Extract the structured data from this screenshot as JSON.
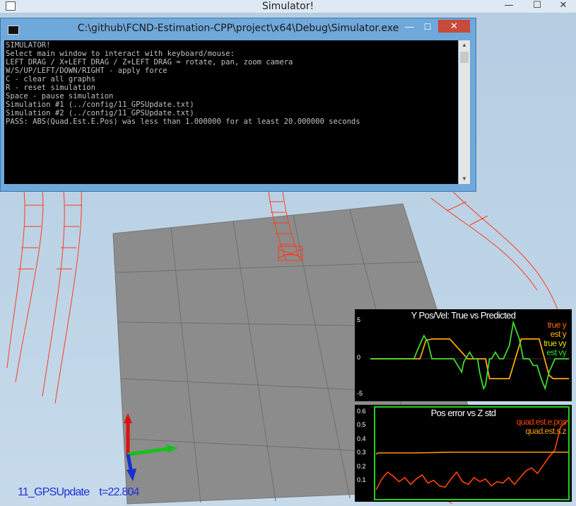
{
  "window": {
    "title": "Simulator!",
    "minimize": "—",
    "maximize": "☐",
    "close": "✕"
  },
  "console": {
    "title": "C:\\github\\FCND-Estimation-CPP\\project\\x64\\Debug\\Simulator.exe",
    "minimize": "—",
    "maximize": "☐",
    "close": "✕",
    "scroll_up": "▲",
    "scroll_down": "▼",
    "lines": [
      "SIMULATOR!",
      "Select main window to interact with keyboard/mouse:",
      "LEFT DRAG / X+LEFT DRAG / Z+LEFT DRAG = rotate, pan, zoom camera",
      "W/S/UP/LEFT/DOWN/RIGHT - apply force",
      "C - clear all graphs",
      "R - reset simulation",
      "Space - pause simulation",
      "Simulation #1 (../config/11_GPSUpdate.txt)",
      "Simulation #2 (../config/11_GPSUpdate.txt)",
      "PASS: ABS(Quad.Est.E.Pos) was less than 1.000000 for at least 20.000000 seconds"
    ]
  },
  "scenario": {
    "name": "11_GPSUpdate",
    "time_label": "t=22.804"
  },
  "chart_data": [
    {
      "type": "line",
      "title": "Y Pos/Vel: True vs Predicted",
      "ylim": [
        -6,
        6
      ],
      "xlim": [
        0,
        100
      ],
      "yticks": [
        "5",
        "0",
        "-5"
      ],
      "series": [
        {
          "name": "true y",
          "color": "#ff6a00",
          "x": [
            0,
            25,
            28,
            31,
            40,
            46,
            49,
            52,
            55,
            58,
            60,
            65,
            70,
            73,
            76,
            78,
            85,
            90,
            92,
            95,
            100
          ],
          "values": [
            0,
            0,
            2.8,
            3,
            3,
            1,
            0,
            0,
            0,
            0,
            -3,
            -3,
            -3,
            0,
            3,
            3,
            3,
            -2.5,
            -3,
            -3,
            -3
          ]
        },
        {
          "name": "est y",
          "color": "#ffb000",
          "x": [
            0,
            25,
            28,
            31,
            40,
            46,
            49,
            52,
            55,
            58,
            60,
            65,
            70,
            73,
            76,
            78,
            85,
            90,
            92,
            95,
            100
          ],
          "values": [
            0,
            0,
            2.8,
            3,
            3,
            1,
            0,
            0,
            0,
            0,
            -3,
            -3,
            -3,
            0,
            3,
            3,
            3,
            -2.5,
            -3,
            -3,
            -3
          ]
        },
        {
          "name": "true vy",
          "color": "#d8e000",
          "x": [
            0,
            22,
            24,
            27,
            29,
            31,
            42,
            44,
            46,
            47,
            50,
            52,
            54,
            55,
            57,
            58,
            60,
            61,
            63,
            65,
            67,
            70,
            72,
            75,
            77,
            80,
            82,
            84,
            86,
            88,
            90,
            93,
            95,
            100
          ],
          "values": [
            0,
            0,
            1.5,
            3.5,
            2.5,
            0,
            0,
            -1,
            -2,
            -0.5,
            1,
            0,
            0,
            -2,
            -4.5,
            -4,
            0,
            0,
            1,
            0,
            0,
            2,
            5.5,
            3,
            0,
            0,
            -1,
            -1,
            -3,
            -4.5,
            -2,
            0,
            0,
            0
          ]
        },
        {
          "name": "est vy",
          "color": "#33dd33",
          "x": [
            0,
            22,
            24,
            27,
            29,
            31,
            42,
            44,
            46,
            47,
            50,
            52,
            54,
            55,
            57,
            58,
            60,
            61,
            63,
            65,
            67,
            70,
            72,
            75,
            77,
            80,
            82,
            84,
            86,
            88,
            90,
            93,
            95,
            100
          ],
          "values": [
            0,
            0,
            1.5,
            3.5,
            2.5,
            0,
            0,
            -1,
            -2,
            -0.5,
            1,
            0,
            0,
            -2,
            -4.5,
            -4,
            0,
            0,
            1,
            0,
            0,
            2,
            5.5,
            3,
            0,
            0,
            -1,
            -1,
            -3,
            -4.5,
            -2,
            0,
            0,
            0
          ]
        }
      ]
    },
    {
      "type": "line",
      "title": "Pos error vs Z std",
      "ylim": [
        0,
        0.62
      ],
      "xlim": [
        0,
        100
      ],
      "yticks": [
        "0.6",
        "0.5",
        "0.4",
        "0.3",
        "0.2",
        "0.1"
      ],
      "series": [
        {
          "name": "quad.est.e.pos",
          "color": "#ff4400",
          "x": [
            0,
            3,
            6,
            9,
            12,
            15,
            18,
            21,
            24,
            27,
            30,
            33,
            36,
            39,
            42,
            45,
            48,
            51,
            54,
            57,
            60,
            63,
            66,
            69,
            72,
            75,
            78,
            81,
            84,
            87,
            90,
            93,
            96,
            100
          ],
          "values": [
            0.04,
            0.12,
            0.17,
            0.14,
            0.1,
            0.13,
            0.08,
            0.12,
            0.15,
            0.09,
            0.11,
            0.07,
            0.06,
            0.12,
            0.17,
            0.1,
            0.08,
            0.13,
            0.1,
            0.12,
            0.07,
            0.1,
            0.09,
            0.13,
            0.08,
            0.13,
            0.18,
            0.2,
            0.16,
            0.22,
            0.28,
            0.33,
            0.5,
            0.55
          ]
        },
        {
          "name": "quad.est.s.z",
          "color": "#ff9900",
          "x": [
            0,
            1,
            5,
            20,
            40,
            60,
            80,
            100
          ],
          "values": [
            0.3,
            0.31,
            0.31,
            0.31,
            0.315,
            0.315,
            0.315,
            0.315
          ]
        }
      ]
    }
  ]
}
